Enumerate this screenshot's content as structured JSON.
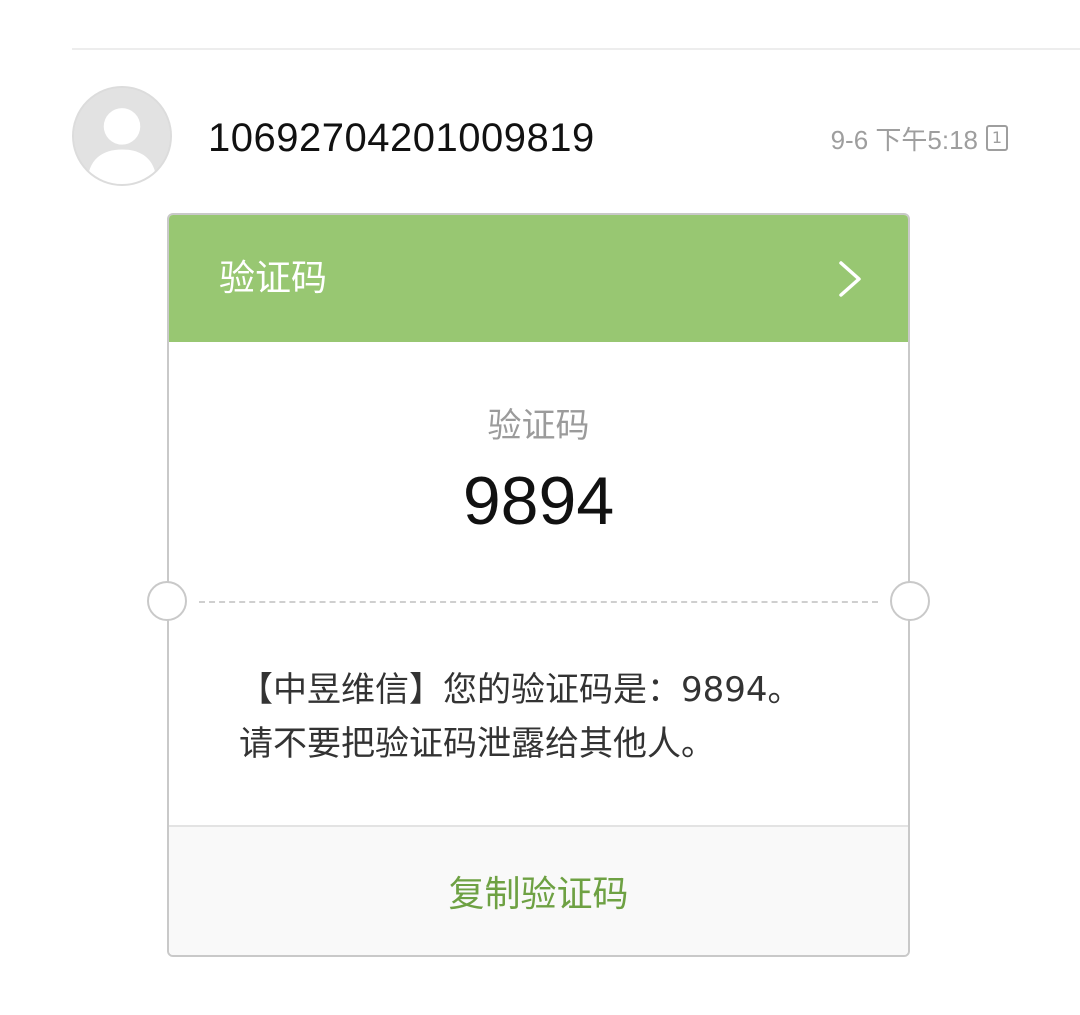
{
  "conversation": {
    "sender": "10692704201009819",
    "time": "9-6 下午5:18",
    "sim_slot": "1",
    "avatar_icon": "person-silhouette-icon"
  },
  "card": {
    "header_title": "验证码",
    "header_icon": "chevron-right-icon",
    "header_color": "#98c772",
    "code_label": "验证码",
    "code_value": "9894",
    "message_line1": "【中昱维信】您的验证码是：9894。",
    "message_line2": "请不要把验证码泄露给其他人。",
    "copy_button_label": "复制验证码",
    "copy_button_color": "#6ea143"
  }
}
